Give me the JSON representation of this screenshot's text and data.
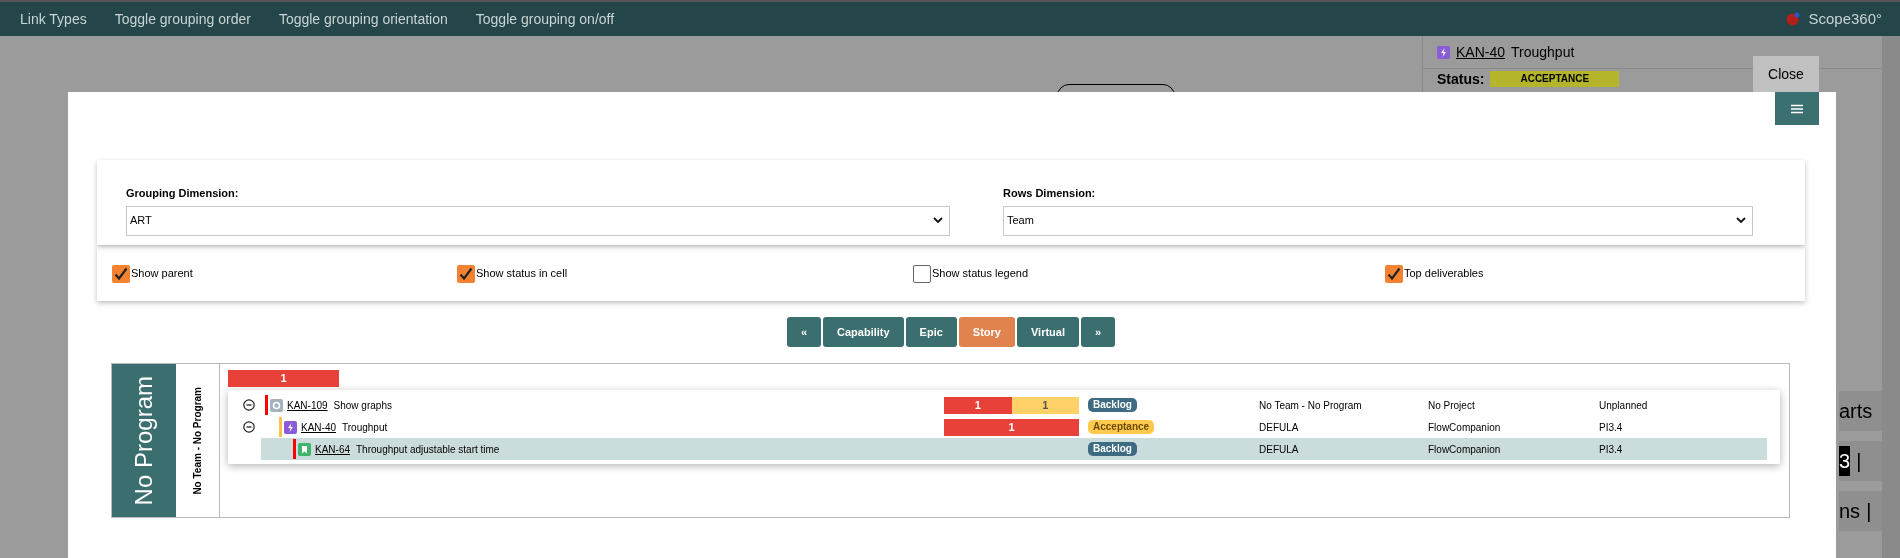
{
  "menu": [
    "Link Types",
    "Toggle grouping order",
    "Toggle grouping orientation",
    "Toggle grouping on/off"
  ],
  "brand": "Scope360°",
  "side_panel": {
    "issue": {
      "kind": "feature",
      "key": "KAN-40",
      "title": "Troughput"
    },
    "status_label": "Status:",
    "status": "ACCEPTANCE",
    "lines": [
      {
        "parts": [
          {
            "text": "arts",
            "inverted": false
          }
        ]
      },
      {
        "parts": [
          {
            "text": "3",
            "inverted": true
          },
          {
            "text": "|",
            "inverted": false
          }
        ]
      },
      {
        "parts": [
          {
            "text": "ns",
            "inverted": false
          },
          {
            "text": "|",
            "inverted": false
          }
        ]
      }
    ]
  },
  "modal": {
    "close_button": "Close",
    "grouping_dimension": {
      "label": "Grouping Dimension:",
      "value": "ART"
    },
    "rows_dimension": {
      "label": "Rows Dimension:",
      "value": "Team"
    },
    "options": [
      {
        "label": "Show parent",
        "checked": true
      },
      {
        "label": "Show status in cell",
        "checked": true
      },
      {
        "label": "Show status legend",
        "checked": false
      },
      {
        "label": "Top deliverables",
        "checked": true
      }
    ],
    "level_buttons": [
      {
        "label": "«",
        "selected": false
      },
      {
        "label": "Capability",
        "selected": false
      },
      {
        "label": "Epic",
        "selected": false
      },
      {
        "label": "Story",
        "selected": true
      },
      {
        "label": "Virtual",
        "selected": false
      },
      {
        "label": "»",
        "selected": false
      }
    ],
    "board": {
      "group_label": "No Program",
      "row_label": "No Team - No Program",
      "summary": [
        {
          "value": "1",
          "color": "#e8413a"
        }
      ],
      "items": [
        {
          "key": "KAN-109",
          "title": "Show graphs",
          "kind": "capability",
          "color": "#ff0000",
          "expanded": true,
          "selected": false,
          "progress": [
            {
              "value": "1",
              "color": "#e8413a"
            },
            {
              "value": "1",
              "color": "#ffd166"
            }
          ],
          "status": {
            "label": "Backlog",
            "color": "#3d6b82"
          },
          "team": "No Team - No Program",
          "project": "No Project",
          "pi": "Unplanned",
          "children": [
            {
              "key": "KAN-40",
              "title": "Troughput",
              "kind": "feature",
              "color": "#ffc04d",
              "expanded": true,
              "selected": false,
              "progress": [
                {
                  "value": "1",
                  "color": "#e8413a"
                }
              ],
              "status": {
                "label": "Acceptance",
                "color": "#ffc94d"
              },
              "team": "DEFULA",
              "project": "FlowCompanion",
              "pi": "PI3.4",
              "children": [
                {
                  "key": "KAN-64",
                  "title": "Throughput adjustable start time",
                  "kind": "story",
                  "color": "#ff0000",
                  "selected": true,
                  "status": {
                    "label": "Backlog",
                    "color": "#3d6b82"
                  },
                  "team": "DEFULA",
                  "project": "FlowCompanion",
                  "pi": "PI3.4"
                }
              ]
            }
          ]
        }
      ]
    }
  }
}
